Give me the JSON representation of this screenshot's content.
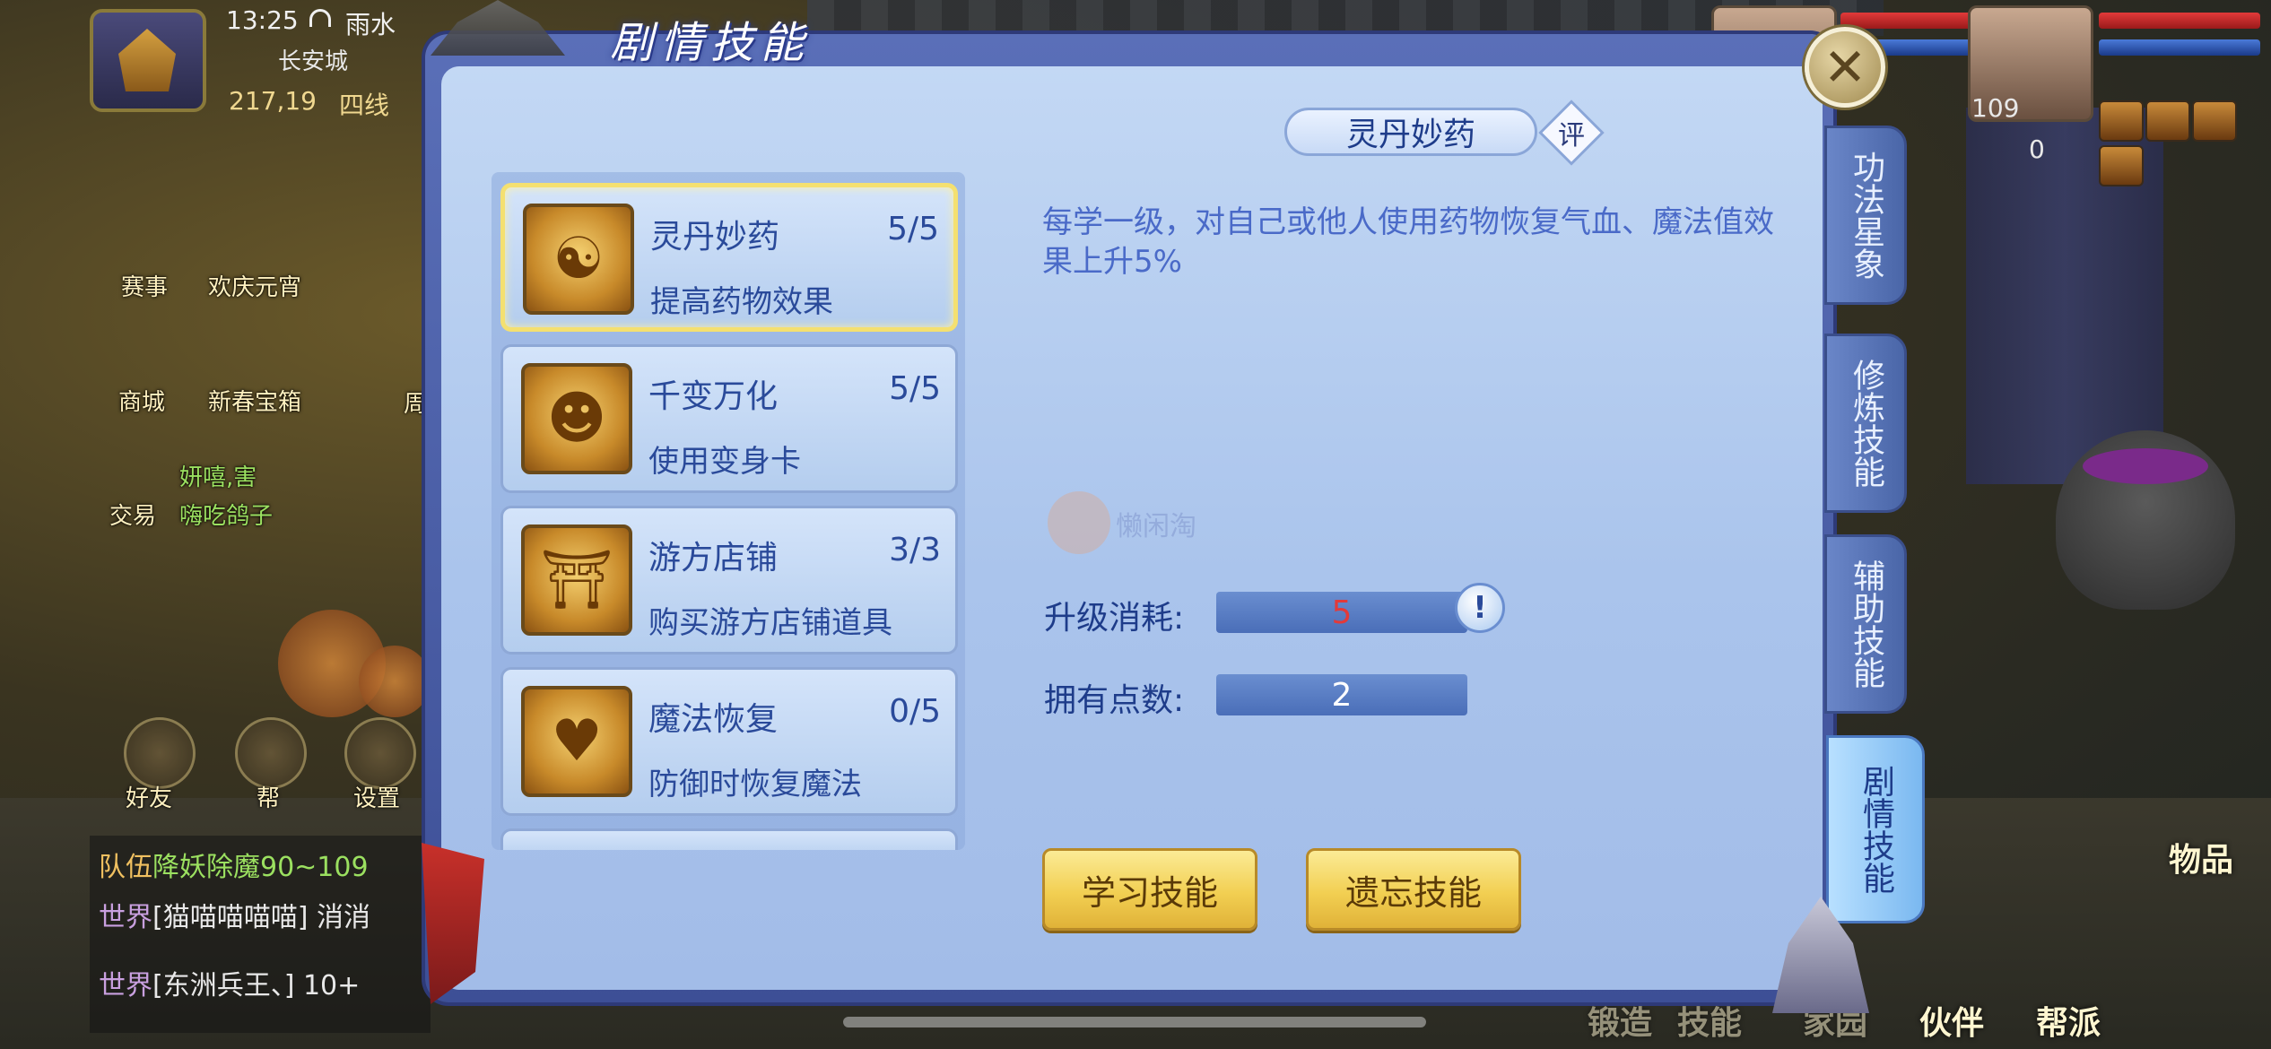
{
  "hud": {
    "time": "13:25",
    "weather": "雨水",
    "city": "长安城",
    "coord": "217,19",
    "line": "四线",
    "buttons": [
      "赛事",
      "欢庆元宵",
      "商城",
      "新春宝箱",
      "交易",
      "好友",
      "帮",
      "设置"
    ],
    "partial_labels": [
      "周"
    ],
    "green_text": [
      "妍嘻,害",
      "嗨吃鸽子"
    ]
  },
  "chat": [
    {
      "tag": "队伍",
      "text": "降妖除魔90~109",
      "tag_type": "team",
      "text_color": "green"
    },
    {
      "tag": "世界",
      "text": "[猫喵喵喵喵] 消消",
      "tag_type": "world",
      "text_color": "white"
    },
    {
      "tag": "世界",
      "text": "[东洲兵王、] 10+",
      "tag_type": "world",
      "text_color": "white"
    }
  ],
  "party": {
    "level": "109",
    "counter": "0"
  },
  "bottom_bar": [
    "锻造",
    "技能",
    "家园",
    "伙伴",
    "帮派"
  ],
  "right_side_label": "物品",
  "dialog": {
    "title": "剧情技能",
    "close_icon": "close-icon",
    "skills": [
      {
        "name": "灵丹妙药",
        "level": "5/5",
        "desc": "提高药物效果",
        "icon": "elixir-icon",
        "glyph": "☯",
        "selected": true
      },
      {
        "name": "千变万化",
        "level": "5/5",
        "desc": "使用变身卡",
        "icon": "mask-icon",
        "glyph": "☻",
        "selected": false
      },
      {
        "name": "游方店铺",
        "level": "3/3",
        "desc": "购买游方店铺道具",
        "icon": "shop-icon",
        "glyph": "⛩",
        "selected": false
      },
      {
        "name": "魔法恢复",
        "level": "0/5",
        "desc": "防御时恢复魔法",
        "icon": "heart-hands-icon",
        "glyph": "♥",
        "selected": false
      }
    ],
    "detail": {
      "name": "灵丹妙药",
      "rate_label": "评",
      "description": "每学一级，对自己或他人使用药物恢复气血、魔法值效果上升5%",
      "upgrade_cost_label": "升级消耗:",
      "upgrade_cost_value": "5",
      "points_label": "拥有点数:",
      "points_value": "2",
      "info_label": "!",
      "watermark": "懒闲淘"
    },
    "buttons": {
      "learn": "学习技能",
      "forget": "遗忘技能"
    },
    "side_tabs": [
      "功法星象",
      "修炼技能",
      "辅助技能",
      "剧情技能"
    ],
    "active_tab": 3
  },
  "colors": {
    "panel_bg": "#aac4ec",
    "frame": "#3d4f96",
    "text_blue": "#2a4a9a",
    "cost_red": "#e23a3a",
    "button_gold": "#f2cf52",
    "selected_border": "#f4e070"
  }
}
